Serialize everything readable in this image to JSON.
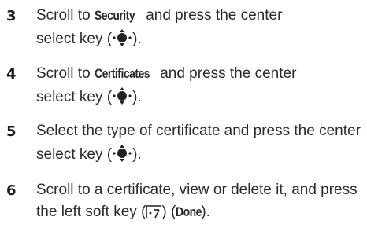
{
  "steps": [
    {
      "number": "3",
      "line1_pre": "Scroll to ",
      "keyword": "Security",
      "line1_post": " and press the center",
      "line2_pre": "select key (",
      "line2_post": ").",
      "icon": "nav-center-key-icon"
    },
    {
      "number": "4",
      "line1_pre": "Scroll to ",
      "keyword": "Certificates",
      "line1_post": " and press the center",
      "line2_pre": "select key (",
      "line2_post": ").",
      "icon": "nav-center-key-icon"
    },
    {
      "number": "5",
      "line1": "Select the type of certificate and press the center",
      "line2_pre": "select key (",
      "line2_post": ").",
      "icon": "nav-center-key-icon"
    },
    {
      "number": "6",
      "line1": "Scroll to a certificate, view or delete it, and press",
      "line2_pre": "the left soft key (",
      "line2_mid": ") (",
      "keyword": "Done",
      "line2_post": ").",
      "icon": "left-soft-key-icon"
    }
  ]
}
